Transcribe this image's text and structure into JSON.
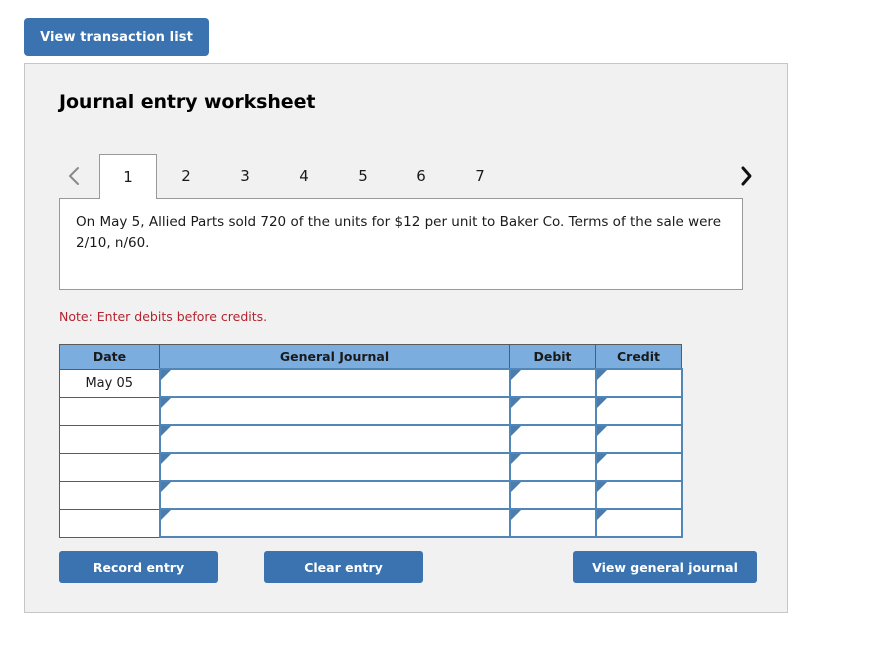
{
  "top_bar": {
    "view_transaction_label": "View transaction list"
  },
  "worksheet": {
    "title": "Journal entry worksheet",
    "nav": {
      "prev_icon": "chevron-left-icon",
      "next_icon": "chevron-right-icon"
    },
    "tabs": [
      {
        "label": "1",
        "active": true
      },
      {
        "label": "2",
        "active": false
      },
      {
        "label": "3",
        "active": false
      },
      {
        "label": "4",
        "active": false
      },
      {
        "label": "5",
        "active": false
      },
      {
        "label": "6",
        "active": false
      },
      {
        "label": "7",
        "active": false
      }
    ],
    "description": "On May 5, Allied Parts sold 720 of the units for $12 per unit to Baker Co. Terms of the sale were 2/10, n/60.",
    "note": "Note: Enter debits before credits."
  },
  "journal": {
    "headers": [
      "Date",
      "General Journal",
      "Debit",
      "Credit"
    ],
    "rows": [
      {
        "date": "May 05",
        "account": "",
        "debit": "",
        "credit": ""
      },
      {
        "date": "",
        "account": "",
        "debit": "",
        "credit": ""
      },
      {
        "date": "",
        "account": "",
        "debit": "",
        "credit": ""
      },
      {
        "date": "",
        "account": "",
        "debit": "",
        "credit": ""
      },
      {
        "date": "",
        "account": "",
        "debit": "",
        "credit": ""
      },
      {
        "date": "",
        "account": "",
        "debit": "",
        "credit": ""
      }
    ]
  },
  "actions": {
    "record_label": "Record entry",
    "clear_label": "Clear entry",
    "view_journal_label": "View general journal"
  },
  "colors": {
    "button_blue": "#3a73b0",
    "table_header_blue": "#7badde",
    "input_border_blue": "#5186b8",
    "note_red": "#b32430",
    "panel_gray": "#f1f1f1"
  }
}
